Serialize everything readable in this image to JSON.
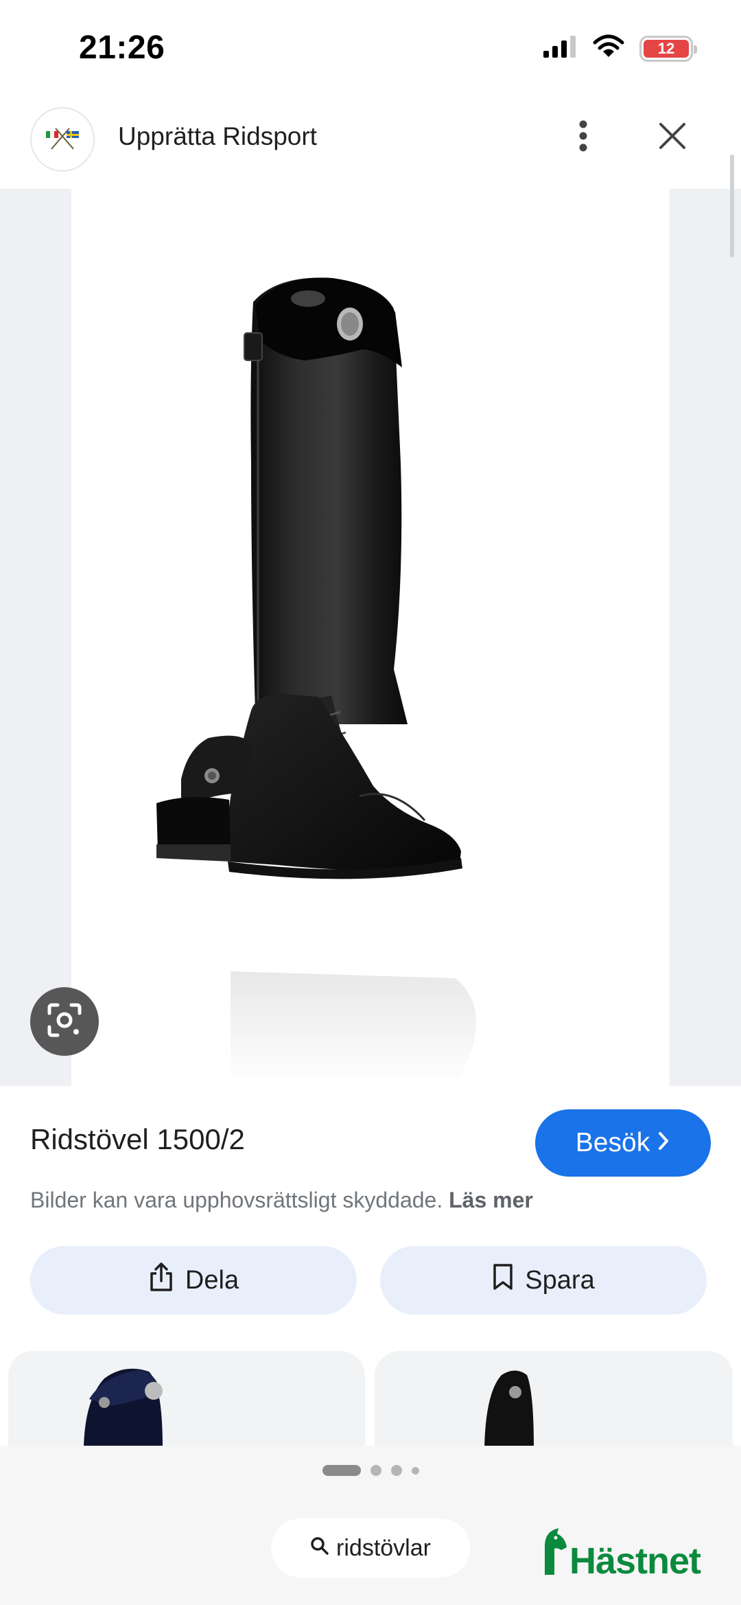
{
  "status_bar": {
    "time": "21:26",
    "battery": "12"
  },
  "header": {
    "site_title": "Upprätta Ridsport",
    "logo_icon": "flags-icon",
    "more_icon": "more-vert-icon",
    "close_icon": "close-icon"
  },
  "product": {
    "title": "Ridstövel 1500/2",
    "visit_label": "Besök",
    "copyright_text": "Bilder kan vara upphovsrättsligt skyddade.",
    "read_more_label": "Läs mer"
  },
  "actions": {
    "share_label": "Dela",
    "save_label": "Spara"
  },
  "bottom": {
    "search_query": "ridstövlar",
    "brand_name": "Hästnet",
    "page_count": 4,
    "active_page": 1
  },
  "colors": {
    "accent_blue": "#1a73e8",
    "button_tint": "#e8effb",
    "brand_green": "#0b8a3d"
  }
}
